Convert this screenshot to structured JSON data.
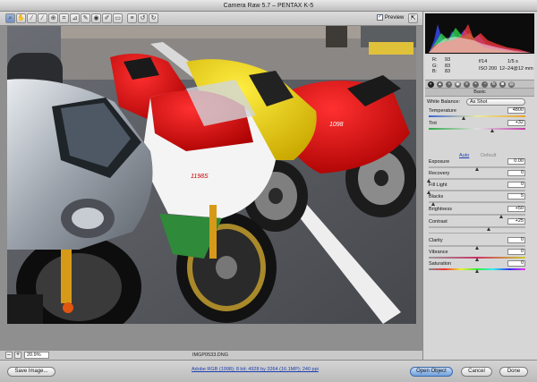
{
  "window": {
    "title": "Camera Raw 5.7  –  PENTAX K-5"
  },
  "toolbar": {
    "tools": [
      {
        "name": "zoom-tool-icon",
        "glyph": "⌕"
      },
      {
        "name": "hand-tool-icon",
        "glyph": "✋"
      },
      {
        "name": "white-balance-tool-icon",
        "glyph": "⁄"
      },
      {
        "name": "color-sampler-tool-icon",
        "glyph": "⁄"
      },
      {
        "name": "targeted-adjustment-tool-icon",
        "glyph": "⊕"
      },
      {
        "name": "crop-tool-icon",
        "glyph": "⌗"
      },
      {
        "name": "straighten-tool-icon",
        "glyph": "⊿"
      },
      {
        "name": "spot-removal-tool-icon",
        "glyph": "✎"
      },
      {
        "name": "red-eye-tool-icon",
        "glyph": "◉"
      },
      {
        "name": "adjustment-brush-icon",
        "glyph": "✐"
      },
      {
        "name": "graduated-filter-icon",
        "glyph": "▭"
      },
      {
        "name": "preferences-icon",
        "glyph": "≡"
      },
      {
        "name": "rotate-ccw-icon",
        "glyph": "↺"
      },
      {
        "name": "rotate-cw-icon",
        "glyph": "↻"
      }
    ],
    "preview_label": "Preview",
    "preview_checked": "✓"
  },
  "status": {
    "zoom_minus": "–",
    "zoom_plus": "+",
    "zoom": "20.9%",
    "filename": "IMGP0533.DNG"
  },
  "footer": {
    "save_label": "Save Image...",
    "workflow": "Adobe RGB (1998); 8 bit; 4928 by 3264 (16.1MP); 240 ppi",
    "open_label": "Open Object",
    "cancel_label": "Cancel",
    "done_label": "Done"
  },
  "readout": {
    "r_label": "R:",
    "g_label": "G:",
    "b_label": "B:",
    "r": "93",
    "g": "83",
    "b": "83",
    "aperture": "f/14",
    "shutter": "1/5 s",
    "iso": "ISO 200",
    "lens": "12–24@12 mm"
  },
  "panel": {
    "tab_glyphs": [
      "◐",
      "▲",
      "◑",
      "▣",
      "≡",
      "◓",
      "◔",
      "fx",
      "◙",
      "▤"
    ],
    "section": "Basic",
    "wb_label": "White Balance:",
    "wb_value": "As Shot",
    "auto": "Auto",
    "default": "Default",
    "sliders": [
      {
        "label": "Temperature",
        "value": "4800",
        "level": 0.37
      },
      {
        "label": "Tint",
        "value": "+32",
        "level": 0.66
      },
      {
        "label": "Exposure",
        "value": "0.00",
        "level": 0.5
      },
      {
        "label": "Recovery",
        "value": "0",
        "level": 0.0
      },
      {
        "label": "Fill Light",
        "value": "0",
        "level": 0.0
      },
      {
        "label": "Blacks",
        "value": "5",
        "level": 0.05
      },
      {
        "label": "Brightness",
        "value": "+50",
        "level": 0.75
      },
      {
        "label": "Contrast",
        "value": "+25",
        "level": 0.625
      },
      {
        "label": "Clarity",
        "value": "0",
        "level": 0.5
      },
      {
        "label": "Vibrance",
        "value": "0",
        "level": 0.5
      },
      {
        "label": "Saturation",
        "value": "0",
        "level": 0.5
      }
    ]
  }
}
